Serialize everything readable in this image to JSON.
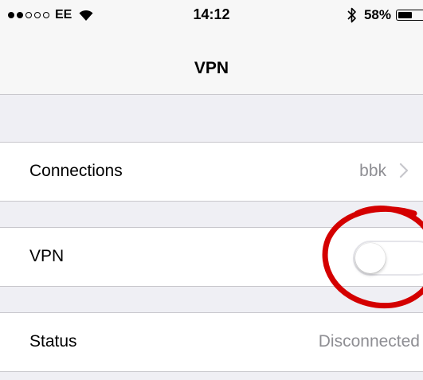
{
  "status_bar": {
    "carrier": "EE",
    "time": "14:12",
    "battery_percent": "58%",
    "battery_level": 0.58,
    "signal_bars": 2,
    "signal_total": 5
  },
  "nav": {
    "title": "VPN"
  },
  "rows": {
    "connections": {
      "label": "Connections",
      "value": "bbk"
    },
    "vpn": {
      "label": "VPN",
      "toggle_on": false
    },
    "status": {
      "label": "Status",
      "value": "Disconnected"
    }
  },
  "annotation": {
    "color": "#d40000"
  }
}
